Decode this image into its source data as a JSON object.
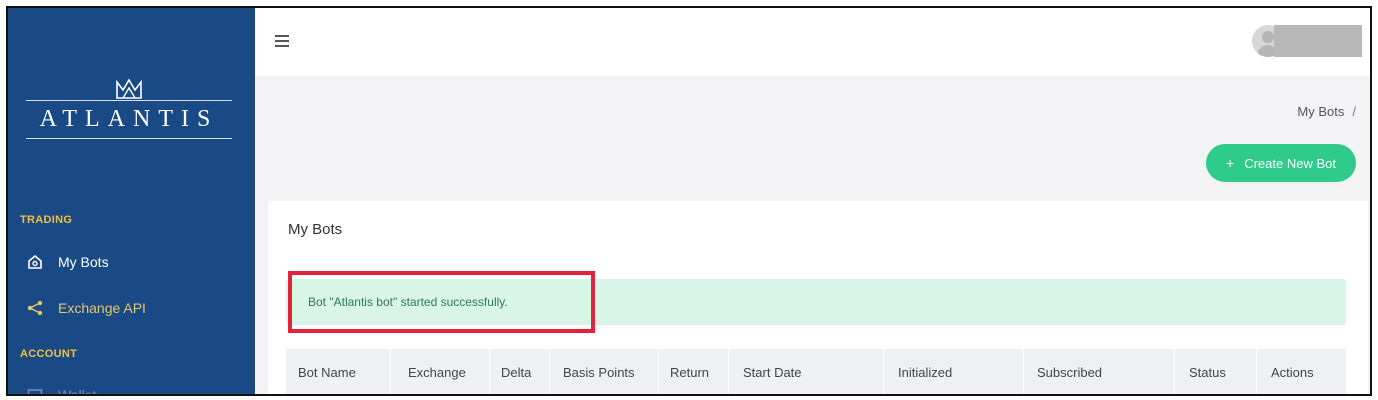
{
  "brand": {
    "name": "ATLANTIS"
  },
  "sidebar": {
    "sections": [
      {
        "title": "TRADING"
      },
      {
        "title": "ACCOUNT"
      }
    ],
    "items": [
      {
        "label": "My Bots",
        "icon": "home-icon"
      },
      {
        "label": "Exchange API",
        "icon": "share-icon"
      },
      {
        "label": "Wallet",
        "icon": "wallet-icon"
      }
    ]
  },
  "header": {
    "breadcrumb": {
      "current": "My Bots",
      "separator": "/"
    },
    "create_button": {
      "plus": "+",
      "label": "Create New Bot"
    }
  },
  "main": {
    "title": "My Bots",
    "alert": {
      "message": "Bot \"Atlantis bot\" started successfully."
    },
    "table": {
      "columns": [
        "Bot Name",
        "Exchange",
        "Delta",
        "Basis Points",
        "Return",
        "Start Date",
        "Initialized",
        "Subscribed",
        "Status",
        "Actions"
      ]
    }
  },
  "colors": {
    "sidebar_bg": "#1a4a85",
    "accent_green": "#2ecb8a",
    "alert_bg": "#d8f5e8",
    "highlight_red": "#e3223c",
    "section_title": "#f0c040"
  }
}
